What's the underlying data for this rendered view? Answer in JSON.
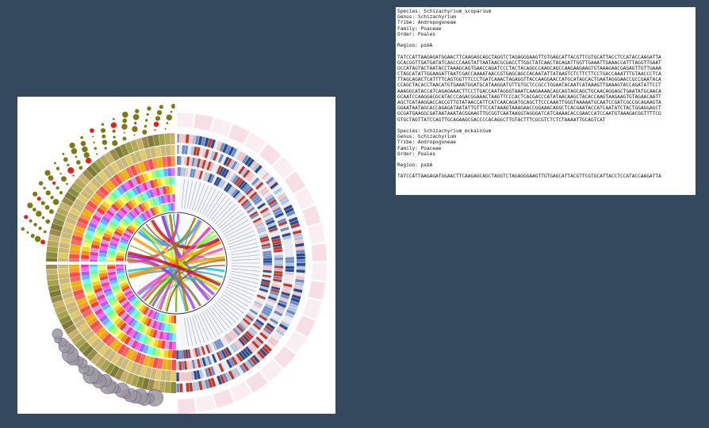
{
  "records": [
    {
      "species": "Species: Schizachyrium_scoparium",
      "genus": "Genus: Schizachyrium",
      "tribe": "Tribe: Andropogoneae",
      "family": "Family: Poaceae",
      "order": "Order: Poales",
      "region": "Region: psbA",
      "sequence": [
        "TATCCATTAAGAGATGGAACTTCAAGAGCAGCTAGGTCTAGAGGGAAGTTGTGAGCATTACGTTCGTGCATTACCTCCATACCAAGATTA",
        "GCACGGTTGATGATATCAGCCCAAGTATTAATAACGCGACCTTGGCTATCAACTACAGATTGGTTGAAATTGAAACCATTTAGGTTGAAT",
        "GCCATAGTACTAATACCTAAAGCAGTGAACCAGATCCCTACTACAGGCCAAGCAGCCAAGAAGAAGTGTAAAGAACGAGAGTTGTTGAAA",
        "CTAGCATATTGGAAGATTAATCGACCAAAATAACCGTGAGCAGCCACAATATTATAAGTCTCTTCTTCCTGACCAAATTTGTAACCCTCA",
        "TTAGCAGACTCATTTTCAGTGGTTTCCCTGATCAAACTAGAGGTTACCAAGGAACCATGCATAGCACTGAATAGGGAACCGCCGAATACA",
        "CCAGCTACACCTAACATGTGAAATGGATGCATAAGGATGTTGTGCTCCGCCTGGAATACAATCATAAAGTTGAAAGTACCAGATATTCCT",
        "AAAGGCATACCATCAGAGAAACTTCCTTGACCAATAGGGTAAATCAAGAAAACAGCAGTAGCAGCTGCAACAGGAGCTGAATATGCAACA",
        "GCAATCCAAGGACGCATACCCAGACGGAAACTAAGTTCCCACTCACGACCCATATAACAAGCTACACCAAGTAAGAAGTGTAGAACAATT",
        "AGCTCATAAGGACCACCGTTGTATAACCATTCATCAACAGATGCAGCTTCCCAAATTGGGTAAAAATGCAATCCGATCGCCGCAGAAGTA",
        "GGAATAATAGCACCAGAGATAATATTGTTTCCATAAAGTAAAGAACCGGAAACAGGCTCACGAATACCATCAATATCTACTGGAGGAGCT",
        "GCGATGAAGGCGATAATAAATACGGAAGTTGCGGTCAATAAGGTAGGGATCATCAAAACACCGAACCATCCAATGTAAAGACGGTTTTCG",
        "GTGCTAGTTATCCAGTTGCAGAAGCGACCCCACAGGCTTGTACTTTCGCGTCTCTCTAAAATTGCAGTCAT"
      ]
    },
    {
      "species": "Species: Schizachyrium_mckainium",
      "genus": "Genus: Schizachyrium",
      "tribe": "Tribe: Andropogoneae",
      "family": "Family: Poaceae",
      "order": "Order: Poales",
      "region": "Region: psbA",
      "sequence": [
        "TATCCATTAAGAGATGGAACTTCAAGAGCAGCTAGGTCTAGAGGGAAGTTGTGAGCATTACGTTCGTGCATTACCTCCATACCAAGATTA"
      ]
    }
  ],
  "colors": {
    "background": "#34495e",
    "panel": "#ffffff",
    "text": "#111111"
  }
}
